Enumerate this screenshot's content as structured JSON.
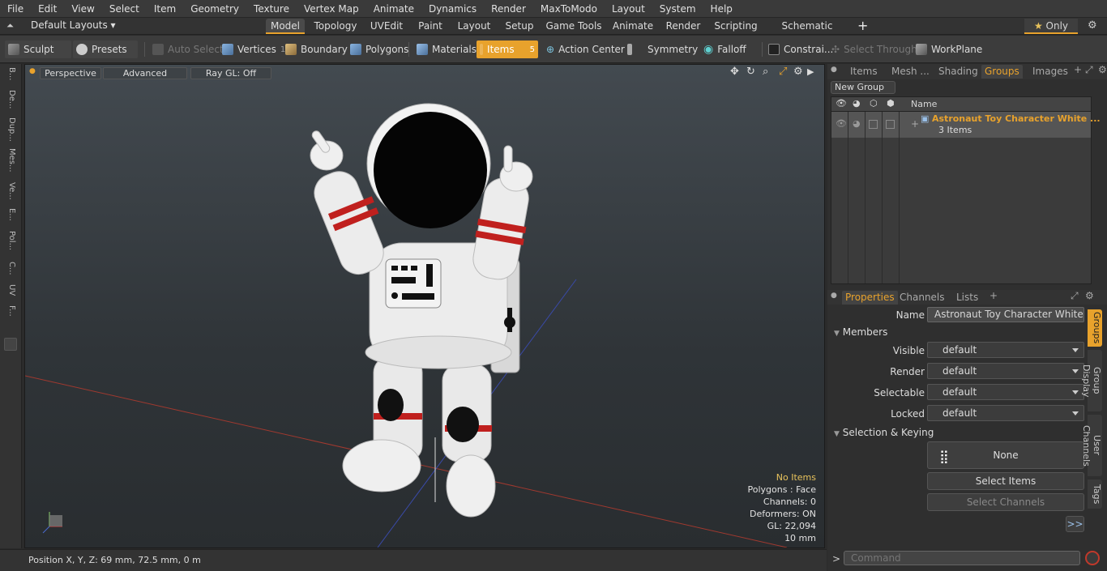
{
  "menu": [
    "File",
    "Edit",
    "View",
    "Select",
    "Item",
    "Geometry",
    "Texture",
    "Vertex Map",
    "Animate",
    "Dynamics",
    "Render",
    "MaxToModo",
    "Layout",
    "System",
    "Help"
  ],
  "layouts": {
    "dropdown": "Default Layouts",
    "only": "Only"
  },
  "layout_tabs": [
    "Model",
    "Topology",
    "UVEdit",
    "Paint",
    "Layout",
    "Setup",
    "Game Tools",
    "Animate",
    "Render",
    "Scripting",
    "Schematic Fusion"
  ],
  "toolbar": {
    "sculpt": "Sculpt",
    "presets": "Presets",
    "auto_select": "Auto Select",
    "vertices": "Vertices",
    "vertices_count": "1",
    "boundary": "Boundary",
    "polygons": "Polygons",
    "materials": "Materials",
    "items": "Items",
    "items_count": "5",
    "action_center": "Action Center",
    "symmetry": "Symmetry",
    "falloff": "Falloff",
    "constraints": "Constrai...",
    "select_through": "Select Through",
    "workplane": "WorkPlane"
  },
  "left_tabs": [
    "B...",
    "De...",
    "Dup...",
    "Mes...",
    "Ve...",
    "E...",
    "Pol...",
    "C...",
    "UV",
    "F..."
  ],
  "viewport": {
    "view_mode": "Perspective",
    "shading": "Advanced",
    "raygl": "Ray GL: Off",
    "info": {
      "items": "No Items",
      "polygons": "Polygons : Face",
      "channels": "Channels: 0",
      "deformers": "Deformers: ON",
      "gl": "GL: 22,094",
      "scale": "10 mm"
    }
  },
  "status": {
    "position": "Position X, Y, Z:  69 mm, 72.5 mm, 0 m"
  },
  "groups_panel": {
    "tabs": [
      "Items",
      "Mesh ...",
      "Shading",
      "Groups",
      "Images"
    ],
    "new_group": "New Group",
    "column_name": "Name",
    "group_name": "Astronaut Toy Character White  ...",
    "group_count": "3 Items"
  },
  "properties": {
    "tabs": [
      "Properties",
      "Channels",
      "Lists"
    ],
    "name_label": "Name",
    "name_value": "Astronaut Toy Character White Happy",
    "members_header": "Members",
    "fields": [
      {
        "label": "Visible",
        "value": "default"
      },
      {
        "label": "Render",
        "value": "default"
      },
      {
        "label": "Selectable",
        "value": "default"
      },
      {
        "label": "Locked",
        "value": "default"
      }
    ],
    "selection_header": "Selection & Keying",
    "none_btn": "None",
    "select_items": "Select Items",
    "select_channels": "Select Channels",
    "more": ">>",
    "side_tabs": [
      "Groups",
      "Group Display",
      "User Channels",
      "Tags"
    ]
  },
  "command": {
    "placeholder": "Command",
    "prompt": ">"
  },
  "colors": {
    "accent": "#e8a22c"
  }
}
